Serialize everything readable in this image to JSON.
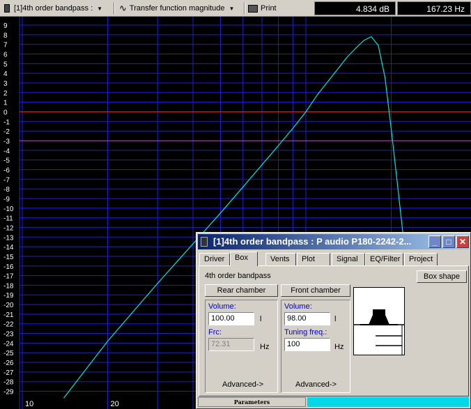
{
  "toolbar": {
    "project_label": "[1]4th order bandpass :",
    "plot_label": "Transfer function magnitude",
    "print_label": "Print",
    "db_readout": "4.834 dB",
    "hz_readout": "167.23 Hz"
  },
  "colors": {
    "curve": "#00e5e5",
    "grid": "#1f1fd0",
    "ref_0db": "#c03030",
    "ref_minus3db": "#d040d0",
    "axis_text": "#ffffff"
  },
  "chart_data": {
    "type": "line",
    "y_ticks": [
      9,
      8,
      7,
      6,
      5,
      4,
      3,
      2,
      1,
      0,
      -1,
      -2,
      -3,
      -4,
      -5,
      -6,
      -7,
      -8,
      -9,
      -10,
      -11,
      -12,
      -13,
      -14,
      -15,
      -16,
      -17,
      -18,
      -19,
      -20,
      -21,
      -22,
      -23,
      -24,
      -25,
      -26,
      -27,
      -28,
      -29
    ],
    "x_tick_labels": [
      {
        "value": 10,
        "label": "10"
      },
      {
        "value": 20,
        "label": "20"
      }
    ],
    "xlim": [
      10,
      220
    ],
    "ylim": [
      -30,
      10
    ],
    "grid": true,
    "reference_lines": [
      0,
      -3
    ],
    "series": [
      {
        "x": [
          14,
          20,
          30,
          40,
          50,
          60,
          70,
          80,
          90,
          100,
          110,
          120,
          130,
          140,
          150,
          160,
          170,
          180,
          190,
          200,
          210,
          220
        ],
        "y": [
          -29.7,
          -23.8,
          -17.8,
          -13.7,
          -10.5,
          -7.8,
          -5.5,
          -3.5,
          -1.7,
          0.0,
          1.8,
          3.2,
          4.5,
          5.7,
          6.6,
          7.4,
          7.8,
          6.9,
          3.6,
          -1.8,
          -7.3,
          -12.7
        ]
      }
    ]
  },
  "dialog": {
    "title": "[1]4th order bandpass : P audio P180-2242-2...",
    "tabs": [
      "Driver",
      "Box",
      "Vents",
      "Plot",
      "Signal",
      "EQ/Filter",
      "Project"
    ],
    "active_tab": "Box",
    "box_type": "4th order bandpass",
    "box_shape_button": "Box shape",
    "rear": {
      "button": "Rear chamber",
      "volume_label": "Volume:",
      "volume_value": "100.00",
      "volume_unit": "l",
      "frc_label": "Frc:",
      "frc_value": "72.31",
      "frc_unit": "Hz",
      "advanced": "Advanced->"
    },
    "front": {
      "button": "Front chamber",
      "volume_label": "Volume:",
      "volume_value": "98.00",
      "volume_unit": "l",
      "tuning_label": "Tuning freq.:",
      "tuning_value": "100",
      "tuning_unit": "Hz",
      "advanced": "Advanced->"
    },
    "statusbar_label": "Parameters"
  }
}
